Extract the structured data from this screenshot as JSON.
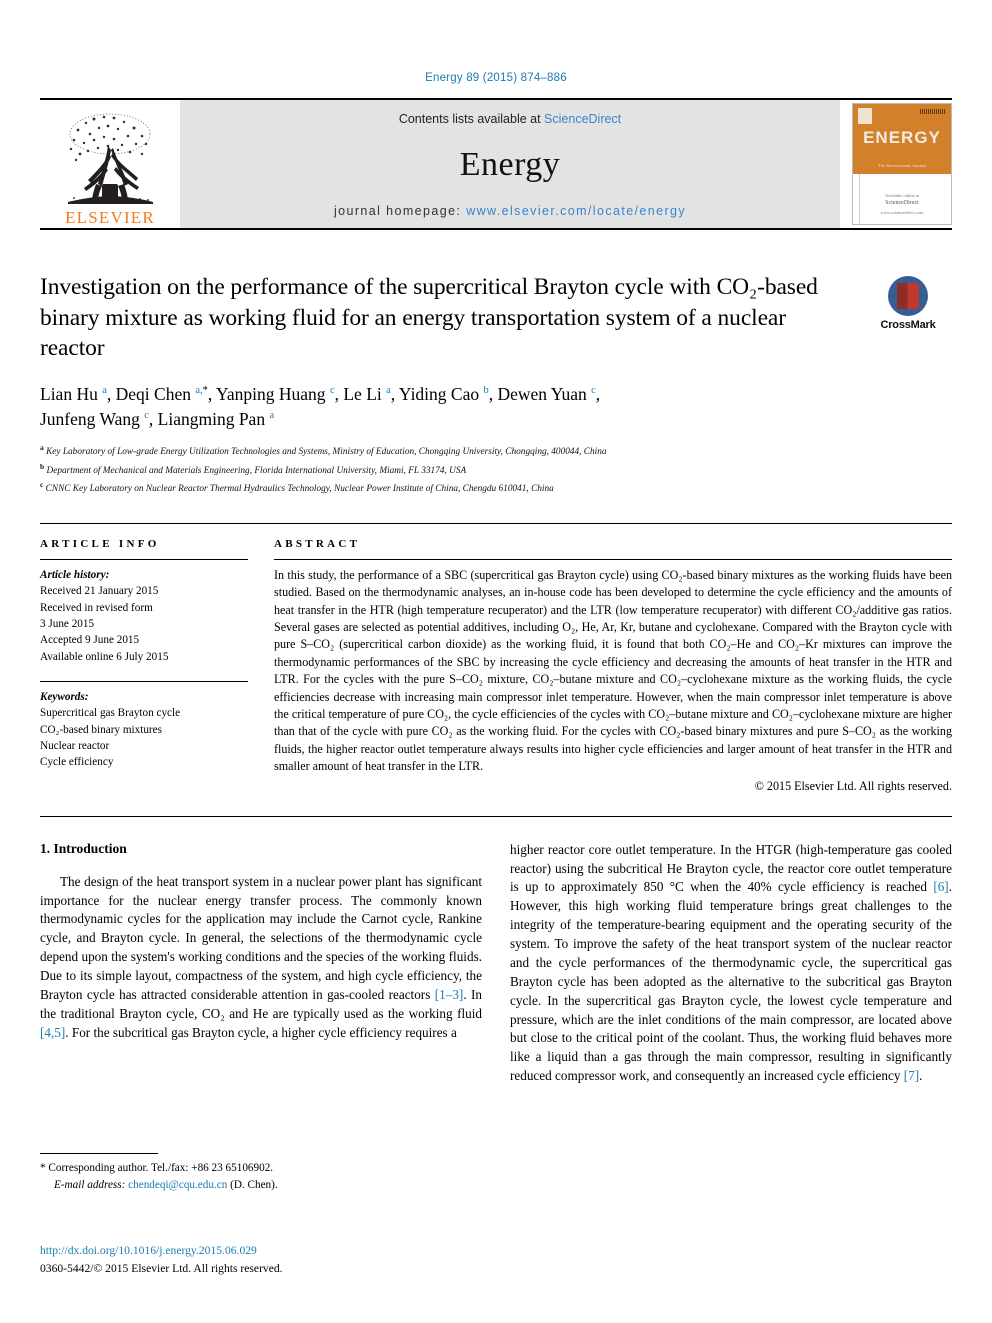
{
  "running_head": "Energy 89 (2015) 874–886",
  "masthead": {
    "publisher": "ELSEVIER",
    "contents_prefix": "Contents lists available at ",
    "contents_link": "ScienceDirect",
    "journal_name": "Energy",
    "homepage_label": "journal homepage: ",
    "homepage_url": "www.elsevier.com/locate/energy",
    "cover_title": "ENERGY",
    "cover_subtitle": "The International Journal",
    "cover_footer_line1": "Available online at",
    "cover_footer_line2": "ScienceDirect",
    "cover_footer_line3": "www.sciencedirect.com"
  },
  "article": {
    "title": "Investigation on the performance of the supercritical Brayton cycle with CO₂-based binary mixture as working fluid for an energy transportation system of a nuclear reactor",
    "crossmark_label": "CrossMark",
    "authors_line1": "Lian Hu <sup>a</sup>, Deqi Chen <sup>a,</sup><sup class=\"star\">*</sup>, Yanping Huang <sup>c</sup>, Le Li <sup>a</sup>, Yiding Cao <sup>b</sup>, Dewen Yuan <sup>c</sup>,",
    "authors_line2": "Junfeng Wang <sup>c</sup>, Liangming Pan <sup>a</sup>",
    "affiliation_a": "Key Laboratory of Low-grade Energy Utilization Technologies and Systems, Ministry of Education, Chongqing University, Chongqing, 400044, China",
    "affiliation_b": "Department of Mechanical and Materials Engineering, Florida International University, Miami, FL 33174, USA",
    "affiliation_c": "CNNC Key Laboratory on Nuclear Reactor Thermal Hydraulics Technology, Nuclear Power Institute of China, Chengdu 610041, China"
  },
  "article_info": {
    "heading": "ARTICLE INFO",
    "history_label": "Article history:",
    "history": [
      "Received 21 January 2015",
      "Received in revised form",
      "3 June 2015",
      "Accepted 9 June 2015",
      "Available online 6 July 2015"
    ],
    "keywords_label": "Keywords:",
    "keywords": [
      "Supercritical gas Brayton cycle",
      "CO₂-based binary mixtures",
      "Nuclear reactor",
      "Cycle efficiency"
    ]
  },
  "abstract": {
    "heading": "ABSTRACT",
    "text": "In this study, the performance of a SBC (supercritical gas Brayton cycle) using CO₂-based binary mixtures as the working fluids have been studied. Based on the thermodynamic analyses, an in-house code has been developed to determine the cycle efficiency and the amounts of heat transfer in the HTR (high temperature recuperator) and the LTR (low temperature recuperator) with different CO₂/additive gas ratios. Several gases are selected as potential additives, including O₂, He, Ar, Kr, butane and cyclohexane. Compared with the Brayton cycle with pure S–CO₂ (supercritical carbon dioxide) as the working fluid, it is found that both CO₂–He and CO₂–Kr mixtures can improve the thermodynamic performances of the SBC by increasing the cycle efficiency and decreasing the amounts of heat transfer in the HTR and LTR. For the cycles with the pure S–CO₂ mixture, CO₂–butane mixture and CO₂–cyclohexane mixture as the working fluids, the cycle efficiencies decrease with increasing main compressor inlet temperature. However, when the main compressor inlet temperature is above the critical temperature of pure CO₂, the cycle efficiencies of the cycles with CO₂–butane mixture and CO₂–cyclohexane mixture are higher than that of the cycle with pure CO₂ as the working fluid. For the cycles with CO₂-based binary mixtures and pure S–CO₂ as the working fluids, the higher reactor outlet temperature always results into higher cycle efficiencies and larger amount of heat transfer in the HTR and smaller amount of heat transfer in the LTR.",
    "copyright": "© 2015 Elsevier Ltd. All rights reserved."
  },
  "introduction": {
    "heading": "1. Introduction",
    "left_para_part1": "The design of the heat transport system in a nuclear power plant has significant importance for the nuclear energy transfer process. The commonly known thermodynamic cycles for the application may include the Carnot cycle, Rankine cycle, and Brayton cycle. In general, the selections of the thermodynamic cycle depend upon the system's working conditions and the species of the working fluids. Due to its simple layout, compactness of the system, and high cycle efficiency, the Brayton cycle has attracted considerable attention in gas-cooled reactors ",
    "ref_1_3": "[1–3]",
    "left_para_part2": ". In the traditional Brayton cycle, CO₂ and He are typically used as the working fluid ",
    "ref_4_5": "[4,5]",
    "left_para_part3": ". For the subcritical gas Brayton cycle, a higher cycle efficiency requires a",
    "right_para_part1": "higher reactor core outlet temperature. In the HTGR (high-temperature gas cooled reactor) using the subcritical He Brayton cycle, the reactor core outlet temperature is up to approximately 850 °C when the 40% cycle efficiency is reached ",
    "ref_6": "[6]",
    "right_para_part2": ". However, this high working fluid temperature brings great challenges to the integrity of the temperature-bearing equipment and the operating security of the system. To improve the safety of the heat transport system of the nuclear reactor and the cycle performances of the thermodynamic cycle, the supercritical gas Brayton cycle has been adopted as the alternative to the subcritical gas Brayton cycle. In the supercritical gas Brayton cycle, the lowest cycle temperature and pressure, which are the inlet conditions of the main compressor, are located above but close to the critical point of the coolant. Thus, the working fluid behaves more like a liquid than a gas through the main compressor, resulting in significantly reduced compressor work, and consequently an increased cycle efficiency ",
    "ref_7": "[7]",
    "right_para_part3": "."
  },
  "footnote": {
    "corresponding": "* Corresponding author. Tel./fax: +86 23 65106902.",
    "email_label": "E-mail address: ",
    "email": "chendeqi@cqu.edu.cn",
    "email_suffix": " (D. Chen)."
  },
  "doi_line": "http://dx.doi.org/10.1016/j.energy.2015.06.029",
  "issn_line": "0360-5442/© 2015 Elsevier Ltd. All rights reserved.",
  "colors": {
    "link_blue": "#1a7db6",
    "banner_gray": "#e3e3e3",
    "elsevier_orange": "#f07c22",
    "cover_orange": "#d2812a"
  }
}
